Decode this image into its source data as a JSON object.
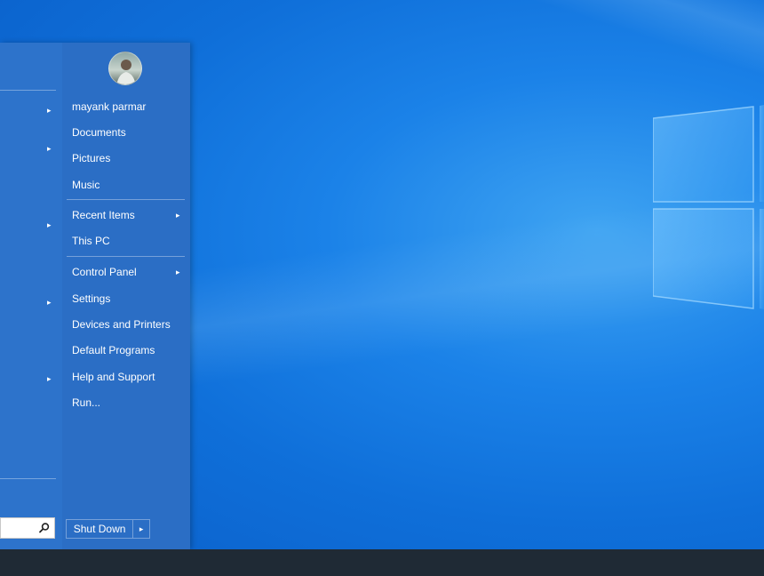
{
  "user": {
    "name": "mayank parmar"
  },
  "menu": {
    "items": [
      {
        "label": "Documents"
      },
      {
        "label": "Pictures"
      },
      {
        "label": "Music"
      },
      {
        "label": "Recent Items",
        "arrow": "▸"
      },
      {
        "label": "This PC"
      },
      {
        "label": "Control Panel",
        "arrow": "▸"
      },
      {
        "label": "Settings"
      },
      {
        "label": "Devices and Printers"
      },
      {
        "label": "Default Programs"
      },
      {
        "label": "Help and Support"
      },
      {
        "label": "Run..."
      }
    ]
  },
  "left_column": {
    "submenu_arrow": "▸"
  },
  "search": {
    "value": "",
    "icon": "magnifier-icon"
  },
  "shutdown": {
    "label": "Shut Down",
    "arrow": "▸"
  },
  "colors": {
    "menu_bg": "#2a6fc6",
    "taskbar_bg": "#1f2a35",
    "desktop_accent": "#1b82e8"
  }
}
